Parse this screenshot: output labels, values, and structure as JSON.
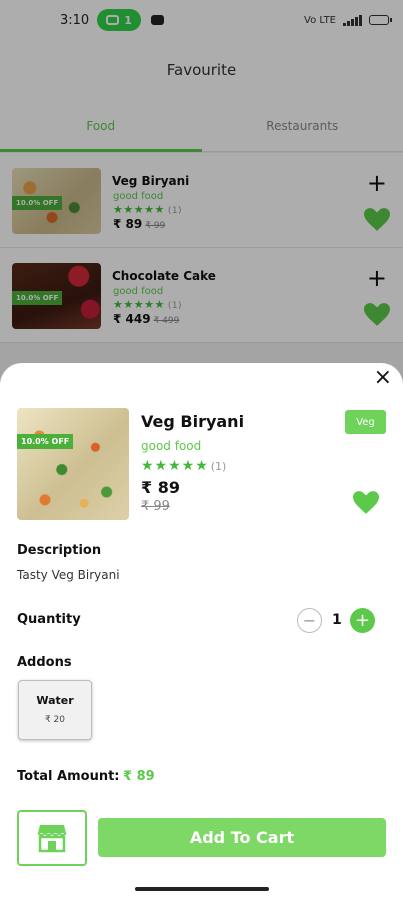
{
  "status_bar": {
    "time": "3:10",
    "pill_count": "1",
    "network": "Vo LTE"
  },
  "header": {
    "title": "Favourite"
  },
  "tabs": [
    {
      "label": "Food",
      "active": true
    },
    {
      "label": "Restaurants",
      "active": false
    }
  ],
  "food_list": [
    {
      "name": "Veg Biryani",
      "subtitle": "good food",
      "stars": "★★★★★",
      "rating_count": "(1)",
      "price": "₹ 89",
      "old_price": "₹ 99",
      "discount": "10.0% OFF",
      "add_icon": "plus-icon",
      "fav_icon": "heart-icon"
    },
    {
      "name": "Chocolate Cake",
      "subtitle": "good food",
      "stars": "★★★★★",
      "rating_count": "(1)",
      "price": "₹ 449",
      "old_price": "₹ 499",
      "discount": "10.0% OFF",
      "add_icon": "plus-icon",
      "fav_icon": "heart-icon"
    }
  ],
  "sheet": {
    "close": "×",
    "discount": "10.0% OFF",
    "name": "Veg Biryani",
    "subtitle": "good food",
    "stars": "★★★★★",
    "rating_count": "(1)",
    "price": "₹ 89",
    "old_price": "₹ 99",
    "veg_badge": "Veg",
    "description_label": "Description",
    "description": "Tasty Veg Biryani",
    "quantity_label": "Quantity",
    "quantity_minus": "−",
    "quantity_value": "1",
    "quantity_plus": "+",
    "addons_label": "Addons",
    "addons": [
      {
        "name": "Water",
        "price": "₹ 20"
      }
    ],
    "total_label": "Total Amount:",
    "total_value": "₹ 89",
    "store_icon": "store-icon",
    "add_to_cart_label": "Add To Cart"
  },
  "colors": {
    "accent": "#5cc94a",
    "accent_light": "#7dd866",
    "star": "#43b83c",
    "badge": "#4caf3a"
  }
}
